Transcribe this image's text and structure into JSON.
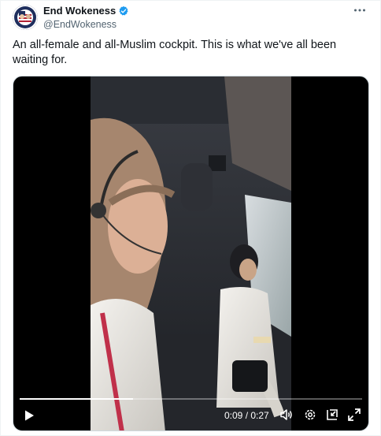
{
  "author": {
    "name": "End Wokeness",
    "handle": "@EndWokeness",
    "verified": true
  },
  "tweet": {
    "text": "An all-female and all-Muslim cockpit. This is what we've all been waiting for."
  },
  "video": {
    "current_time": "0:09",
    "duration": "0:27",
    "time_separator": " / ",
    "progress": 0.33
  },
  "colors": {
    "text": "#0f1419",
    "secondary": "#536471",
    "verified": "#1d9bf0"
  },
  "icons": [
    "more-icon",
    "verified-badge-icon",
    "play-icon",
    "volume-icon",
    "settings-icon",
    "pip-icon",
    "fullscreen-icon"
  ]
}
